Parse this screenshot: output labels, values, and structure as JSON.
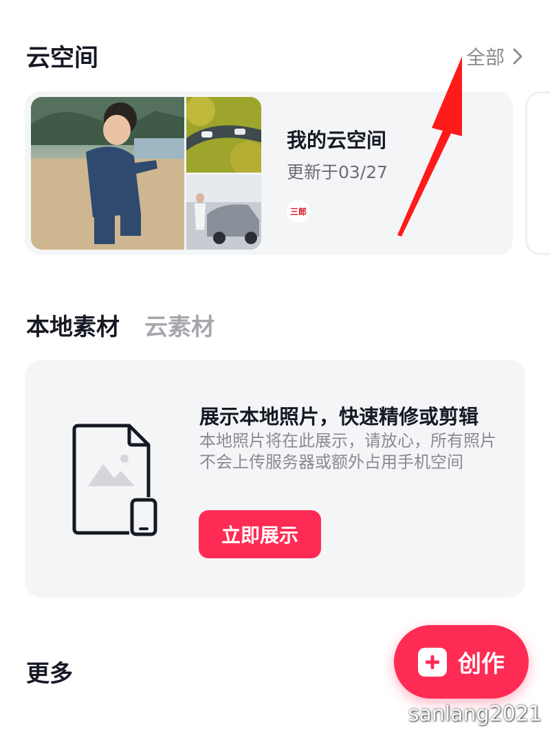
{
  "cloud_space": {
    "title": "云空间",
    "see_all": "全部",
    "card": {
      "name": "我的云空间",
      "updated": "更新于03/27"
    }
  },
  "tabs": [
    {
      "label": "本地素材",
      "active": true
    },
    {
      "label": "云素材",
      "active": false
    }
  ],
  "local_empty": {
    "title": "展示本地照片，快速精修或剪辑",
    "description": "本地照片将在此展示，请放心，所有照片不会上传服务器或额外占用手机空间",
    "button": "立即展示"
  },
  "more": {
    "title": "更多"
  },
  "create_fab": {
    "label": "创作"
  },
  "avatar_logo_text": "三郎",
  "watermark": "sanlang2021",
  "colors": {
    "accent": "#fe2c55",
    "annotation_arrow": "#ff1a1a",
    "card_bg": "#f4f5f7",
    "text_primary": "#161823",
    "text_secondary": "#8a8b91"
  },
  "icons": {
    "see_all": "chevron-right-icon",
    "local_illustration": "photo-document-icon",
    "fab": "plus-square-icon"
  }
}
